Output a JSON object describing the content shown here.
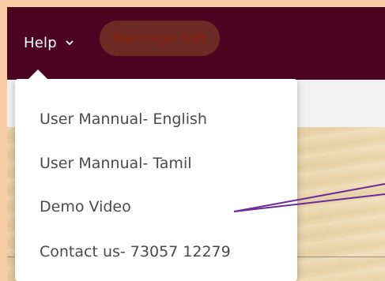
{
  "nav": {
    "help_label": "Help",
    "help_chevron_icon": "chevron-down-icon",
    "pill_label": "Marriage Gift"
  },
  "help_menu": {
    "items": [
      {
        "label": "User Mannual- English"
      },
      {
        "label": "User Mannual- Tamil"
      },
      {
        "label": "Demo Video"
      },
      {
        "label": "Contact us- 73057 12279"
      }
    ]
  },
  "colors": {
    "outer_frame": "#f8cca5",
    "nav_bar": "#4c0520",
    "pill": "#6c2a24",
    "menu_text": "#4a4a4a",
    "annotation_arrow": "#6a2c9a"
  }
}
